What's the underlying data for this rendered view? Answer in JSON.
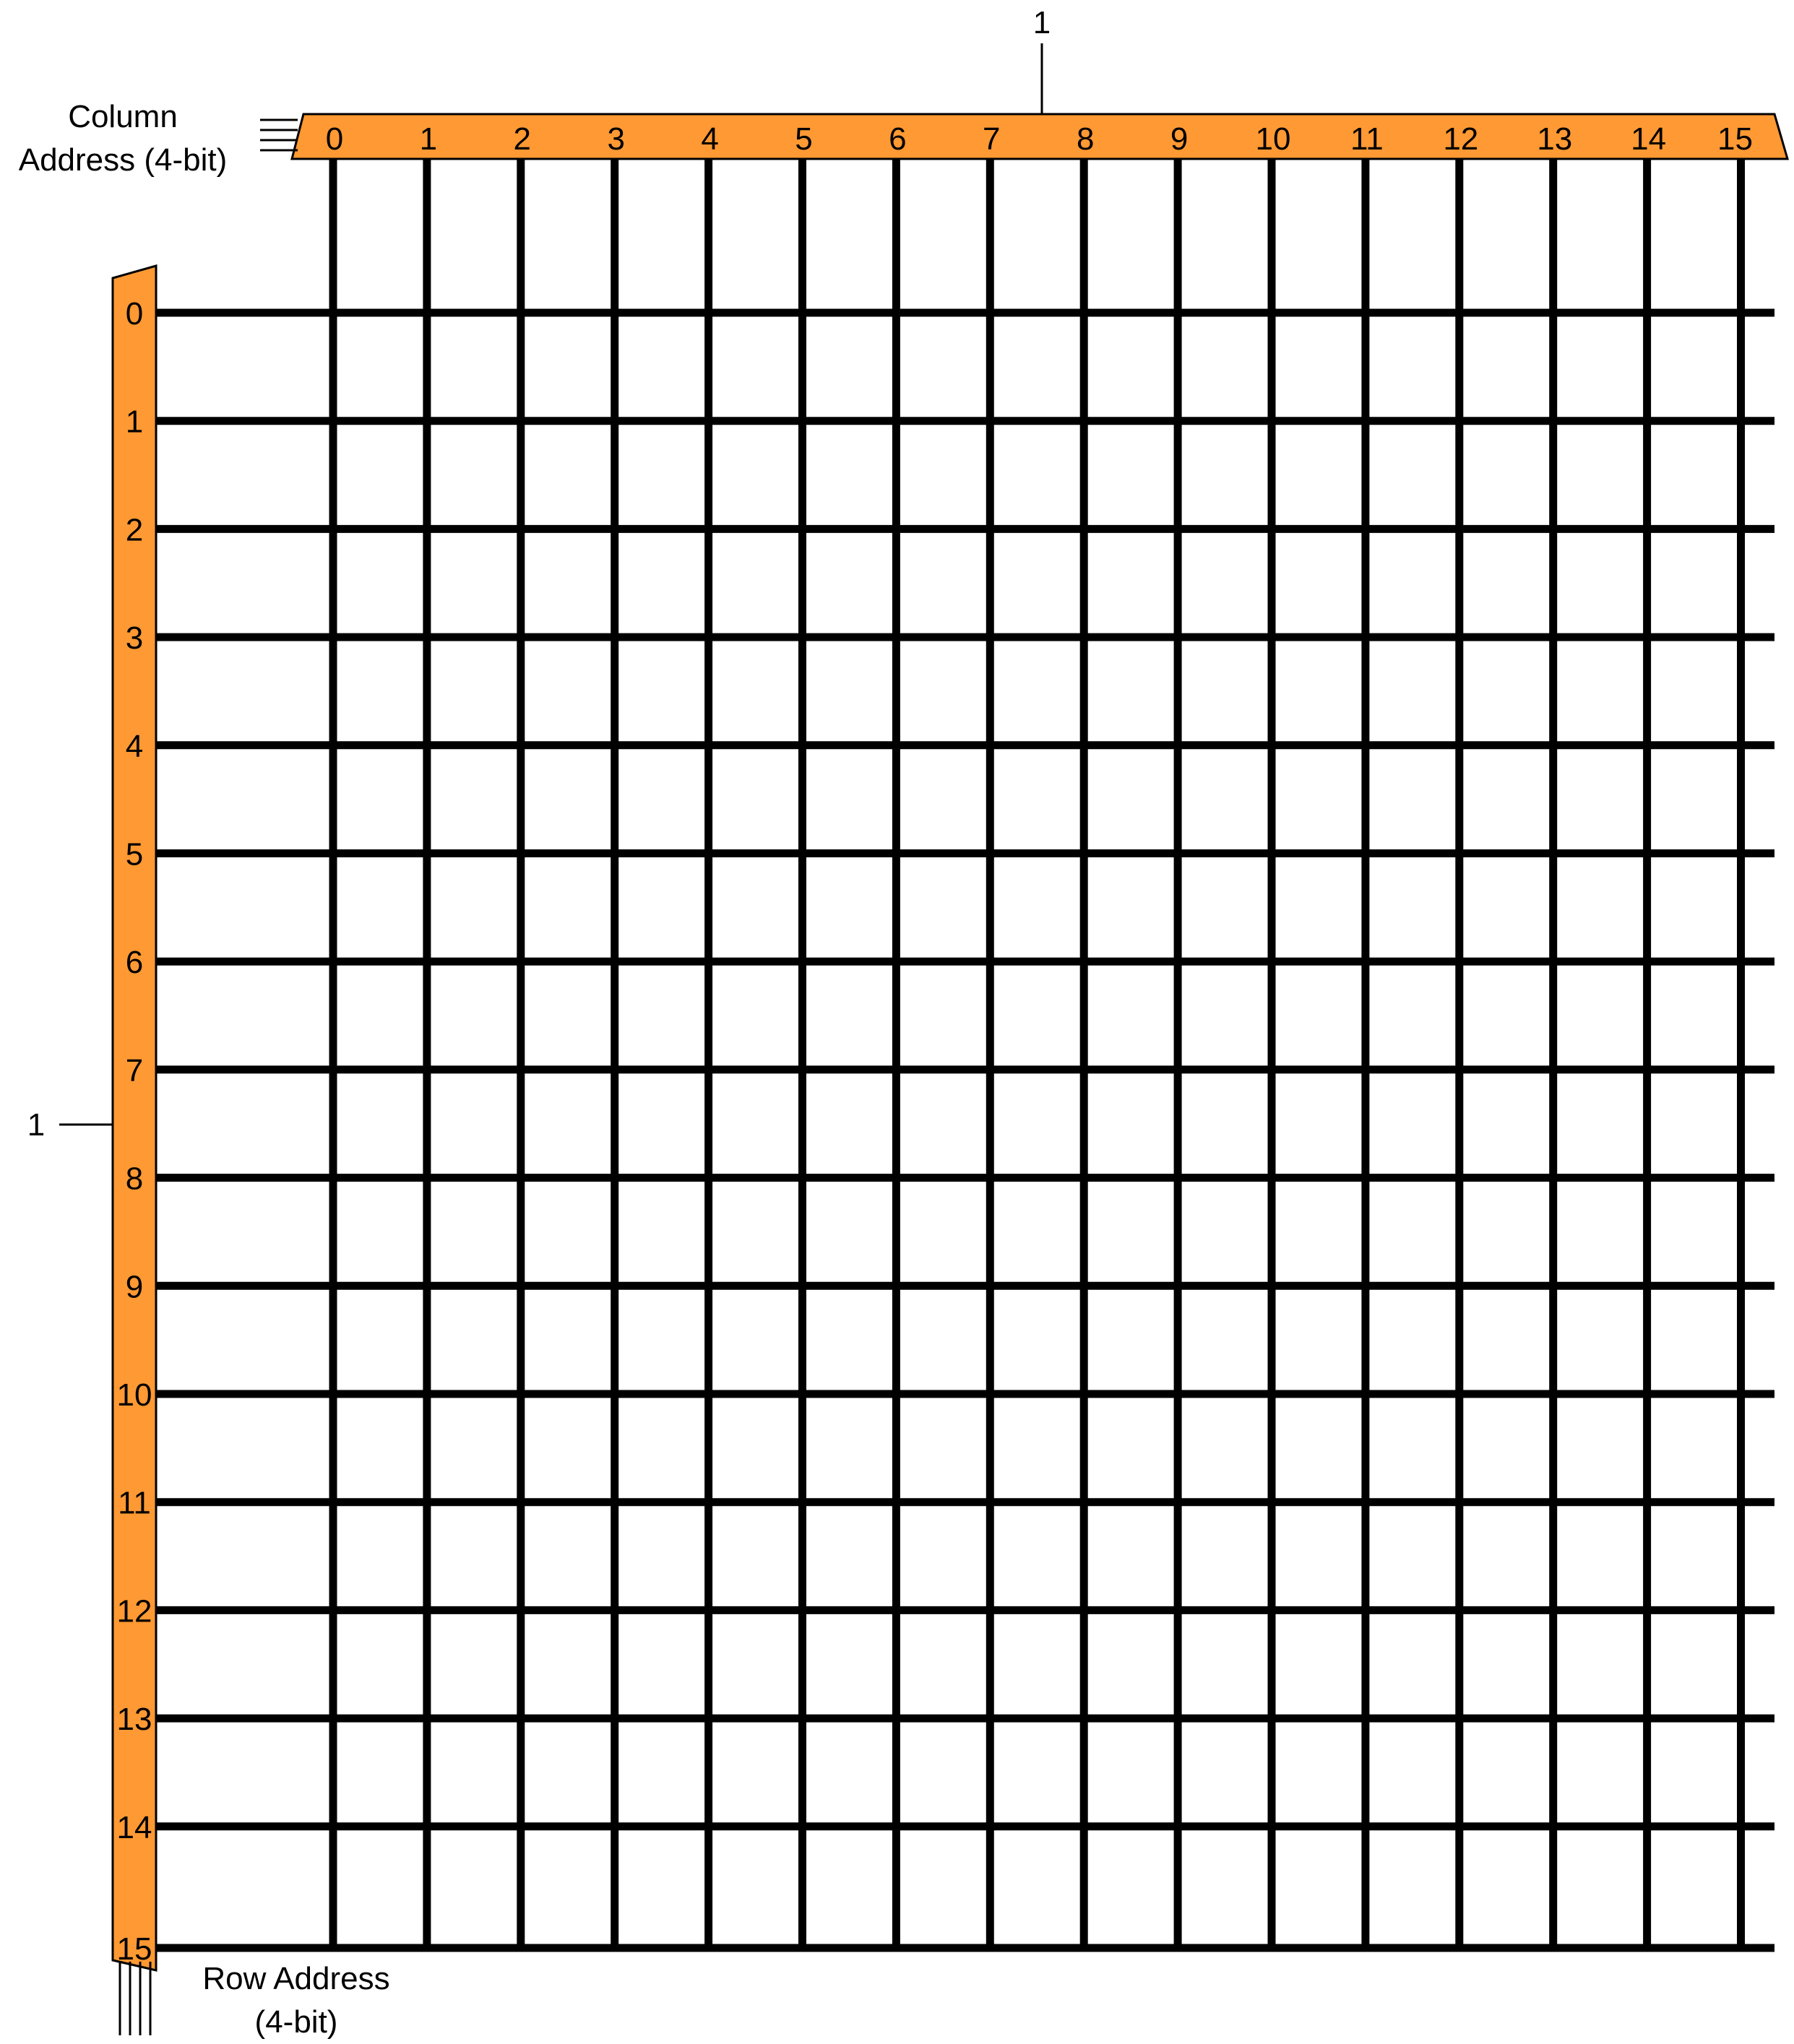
{
  "column_decoder": {
    "label_line1": "Column",
    "label_line2": "Address (4-bit)",
    "output_labels": [
      "0",
      "1",
      "2",
      "3",
      "4",
      "5",
      "6",
      "7",
      "8",
      "9",
      "10",
      "11",
      "12",
      "13",
      "14",
      "15"
    ],
    "enable_label": "1",
    "address_bits": 4
  },
  "row_decoder": {
    "label_line1": "Row Address",
    "label_line2": "(4-bit)",
    "output_labels": [
      "0",
      "1",
      "2",
      "3",
      "4",
      "5",
      "6",
      "7",
      "8",
      "9",
      "10",
      "11",
      "12",
      "13",
      "14",
      "15"
    ],
    "enable_label": "1",
    "address_bits": 4
  },
  "grid": {
    "columns": 16,
    "rows": 16
  },
  "colors": {
    "decoder_fill": "#FF9933",
    "line": "#000000",
    "background": "#FFFFFF"
  }
}
